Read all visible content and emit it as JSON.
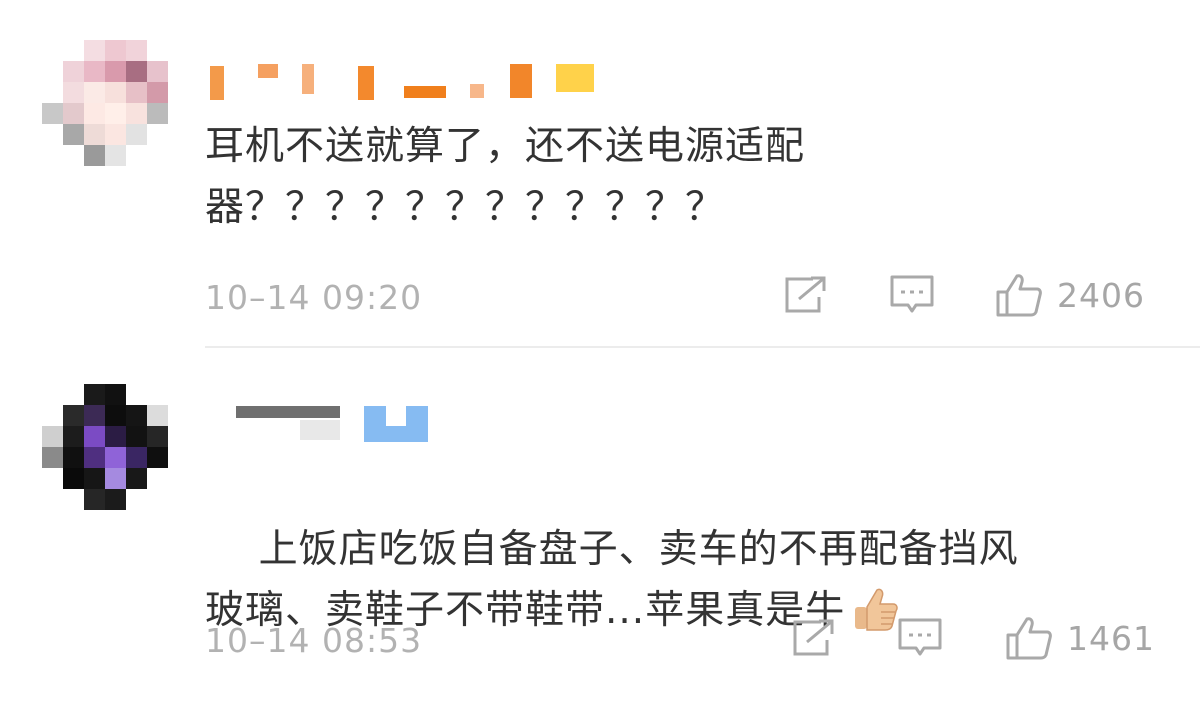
{
  "comments": [
    {
      "text": "耳机不送就算了，还不送电源适配\n器？？？？？？？？？？？？",
      "time": "10–14 09:20",
      "likes": "2406",
      "icons": {
        "share": "share-icon",
        "reply": "comment-icon",
        "like": "thumbs-up-icon"
      },
      "avatar_colors": [
        "#f2d4da",
        "#b8b8b8",
        "#ffe8e4",
        "#d88a9f"
      ]
    },
    {
      "text": "上饭店吃饭自备盘子、卖车的不再配备挡风\n玻璃、卖鞋子不带鞋带...苹果真是牛",
      "time": "10–14 08:53",
      "likes": "1461",
      "icons": {
        "share": "share-icon",
        "reply": "comment-icon",
        "like": "thumbs-up-icon",
        "emoji": "thumbs-up-emoji"
      },
      "avatar_colors": [
        "#111111",
        "#6b3fa0",
        "#9b7fd6",
        "#d0d0d0"
      ]
    }
  ],
  "colors": {
    "name_orange": "#f08a24",
    "name_yellow": "#ffcc33",
    "name_blue": "#7fb5f0",
    "name_gray": "#6f6f6f"
  }
}
